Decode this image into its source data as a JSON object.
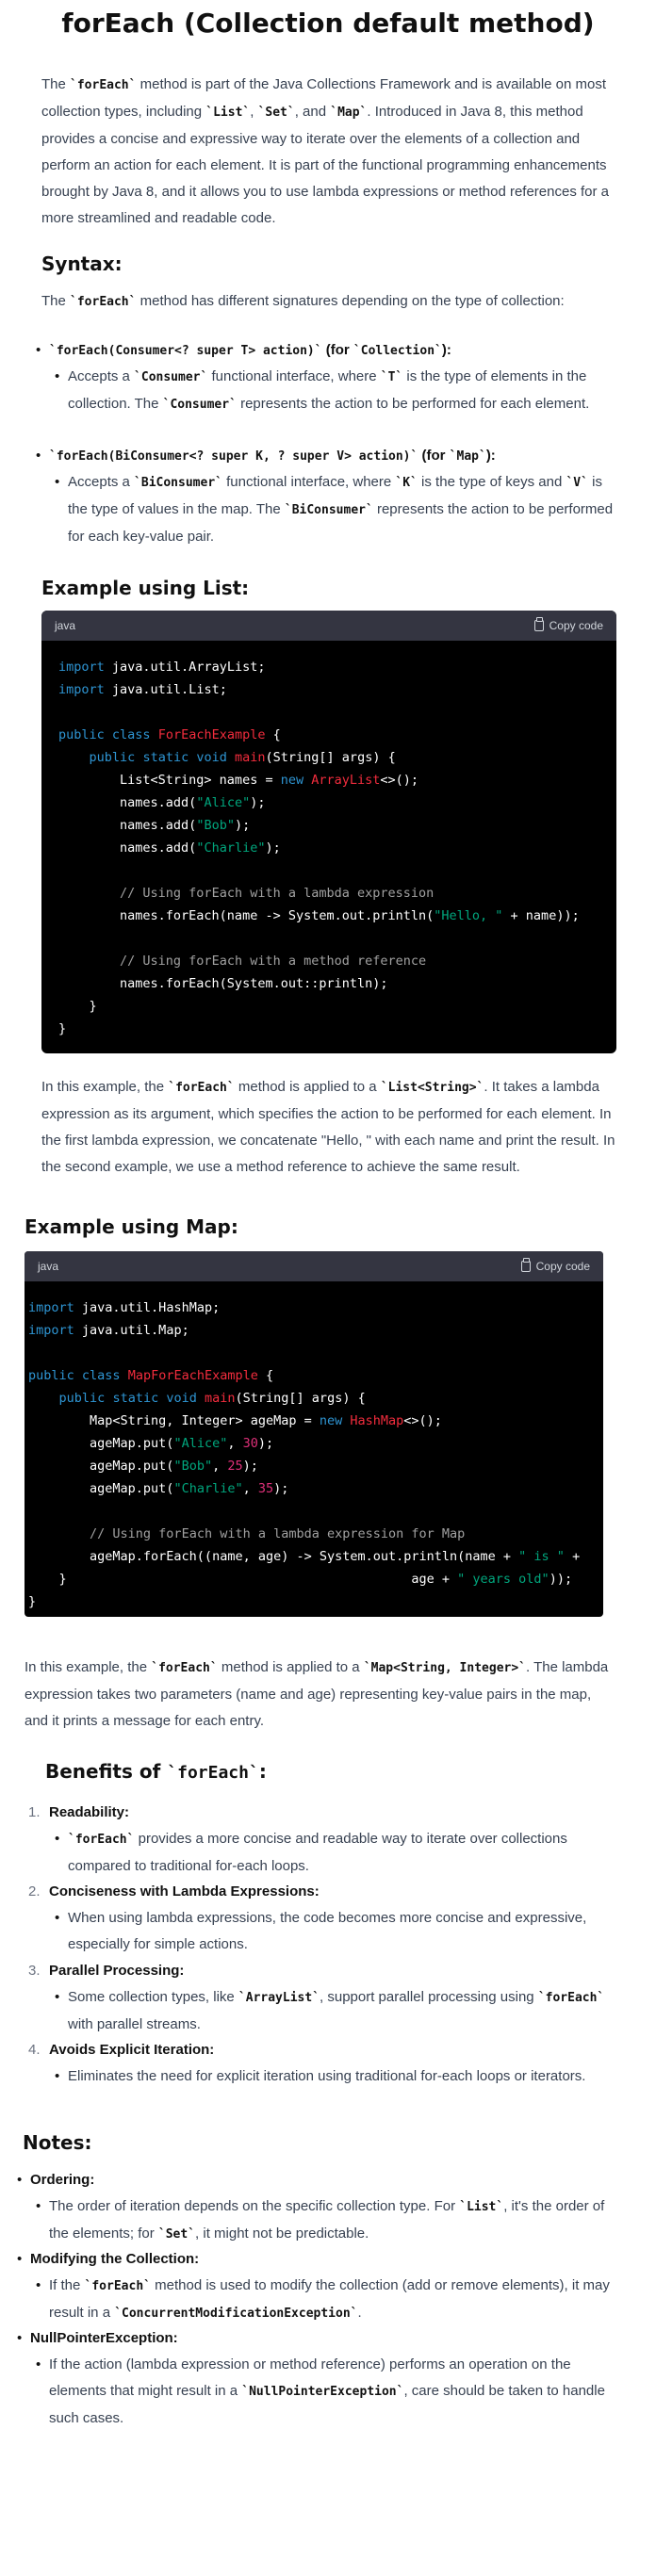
{
  "title": "forEach (Collection default method)",
  "intro": [
    "The ",
    "`forEach`",
    " method is part of the Java Collections Framework and is available on most collection types, including ",
    "`List`",
    ", ",
    "`Set`",
    ", and ",
    "`Map`",
    ". Introduced in Java 8, this method provides a concise and expressive way to iterate over the elements of a collection and perform an action for each element. It is part of the functional programming enhancements brought by Java 8, and it allows you to use lambda expressions or method references for a more streamlined and readable code."
  ],
  "syntax": {
    "heading": "Syntax:",
    "lead": "method has different signatures depending on the type of collection:",
    "lead_pre": "The ",
    "lead_code": "`forEach`",
    "items": [
      {
        "sig": "`forEach(Consumer<? super T> action)`",
        "for": " (for ",
        "forcode": "`Collection`",
        "close": "):",
        "desc_a": "Accepts a ",
        "desc_code1": "`Consumer`",
        "desc_b": " functional interface, where ",
        "desc_code2": "`T`",
        "desc_c": " is the type of elements in the collection. The ",
        "desc_code3": "`Consumer`",
        "desc_d": " represents the action to be performed for each element."
      },
      {
        "sig": "`forEach(BiConsumer<? super K, ? super V> action)`",
        "for": " (for ",
        "forcode": "`Map`",
        "close": "):",
        "desc_a": "Accepts a ",
        "desc_code1": "`BiConsumer`",
        "desc_b": " functional interface, where ",
        "desc_code2": "`K`",
        "desc_c": " is the type of keys and ",
        "desc_code3": "`V`",
        "desc_d": " is the type of values in the map. The ",
        "desc_code4": "`BiConsumer`",
        "desc_e": " represents the action to be performed for each key-value pair."
      }
    ]
  },
  "list_example": {
    "heading": "Example using List:",
    "lang": "java",
    "copy": "Copy code",
    "explain_a": "In this example, the ",
    "explain_code1": "`forEach`",
    "explain_b": " method is applied to a ",
    "explain_code2": "`List<String>`",
    "explain_c": ". It takes a lambda expression as its argument, which specifies the action to be performed for each element. In the first lambda expression, we concatenate \"Hello, \" with each name and print the result. In the second example, we use a method reference to achieve the same result."
  },
  "map_example": {
    "heading": "Example using Map:",
    "lang": "java",
    "copy": "Copy code",
    "explain_a": "In this example, the ",
    "explain_code1": "`forEach`",
    "explain_b": " method is applied to a ",
    "explain_code2": "`Map<String, Integer>`",
    "explain_c": ". The lambda expression takes two parameters (name and age) representing key-value pairs in the map, and it prints a message for each entry."
  },
  "benefits": {
    "heading_pre": "Benefits of ",
    "heading_code": "`forEach`",
    "heading_post": ":",
    "items": [
      {
        "n": "1.",
        "title": "Readability:",
        "desc_code": "`forEach`",
        "desc": " provides a more concise and readable way to iterate over collections compared to traditional for-each loops."
      },
      {
        "n": "2.",
        "title": "Conciseness with Lambda Expressions:",
        "desc": "When using lambda expressions, the code becomes more concise and expressive, especially for simple actions."
      },
      {
        "n": "3.",
        "title": "Parallel Processing:",
        "desc_a": "Some collection types, like ",
        "desc_code": "`ArrayList`",
        "desc_b": ", support parallel processing using ",
        "desc_code2": "`forEach`",
        "desc_c": " with parallel streams."
      },
      {
        "n": "4.",
        "title": "Avoids Explicit Iteration:",
        "desc": "Eliminates the need for explicit iteration using traditional for-each loops or iterators."
      }
    ]
  },
  "notes": {
    "heading": "Notes:",
    "items": [
      {
        "title": "Ordering:",
        "desc_a": "The order of iteration depends on the specific collection type. For ",
        "c1": "`List`",
        "desc_b": ", it's the order of the elements; for ",
        "c2": "`Set`",
        "desc_c": ", it might not be predictable."
      },
      {
        "title": "Modifying the Collection:",
        "desc_a": "If the ",
        "c1": "`forEach`",
        "desc_b": " method is used to modify the collection (add or remove elements), it may result in a ",
        "c2": "`ConcurrentModificationException`",
        "desc_c": "."
      },
      {
        "title": "NullPointerException:",
        "desc_a": "If the action (lambda expression or method reference) performs an operation on the elements that might result in a ",
        "c1": "`NullPointerException`",
        "desc_b": ", care should be taken to handle such cases."
      }
    ]
  }
}
